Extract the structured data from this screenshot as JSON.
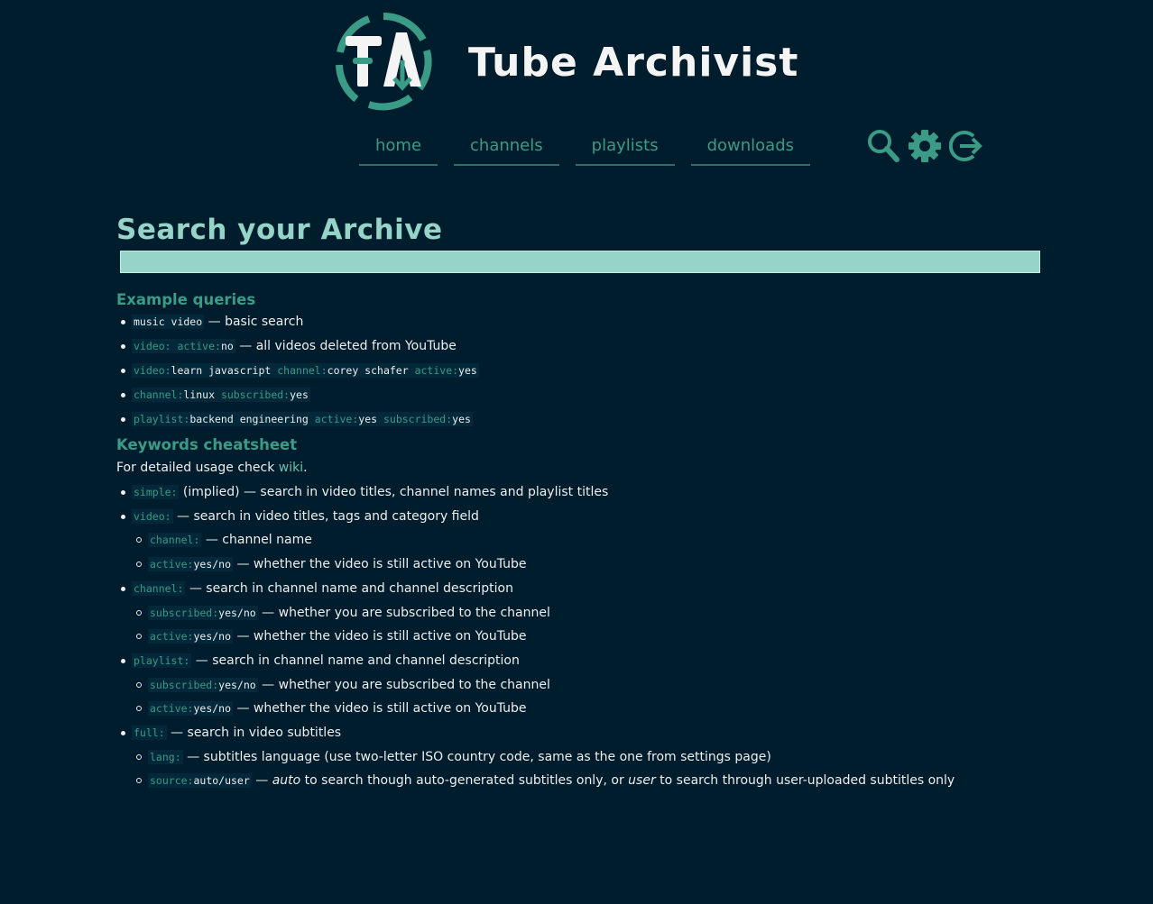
{
  "brand": {
    "title": "Tube Archivist",
    "logo_letters": "TA"
  },
  "nav": {
    "items": [
      {
        "label": "home"
      },
      {
        "label": "channels"
      },
      {
        "label": "playlists"
      },
      {
        "label": "downloads"
      }
    ],
    "icons": [
      "search-icon",
      "gear-icon",
      "logout-icon"
    ]
  },
  "main": {
    "title": "Search your Archive",
    "search": {
      "value": "",
      "placeholder": ""
    },
    "examples_heading": "Example queries",
    "examples": [
      {
        "code": [
          [
            "music video",
            false
          ]
        ],
        "desc": " — basic search"
      },
      {
        "code": [
          [
            "video:",
            true
          ],
          [
            " ",
            false
          ],
          [
            "active:",
            true
          ],
          [
            "no",
            false
          ]
        ],
        "desc": " — all videos deleted from YouTube"
      },
      {
        "code": [
          [
            "video:",
            true
          ],
          [
            "learn javascript ",
            false
          ],
          [
            "channel:",
            true
          ],
          [
            "corey schafer ",
            false
          ],
          [
            "active:",
            true
          ],
          [
            "yes",
            false
          ]
        ],
        "desc": ""
      },
      {
        "code": [
          [
            "channel:",
            true
          ],
          [
            "linux ",
            false
          ],
          [
            "subscribed:",
            true
          ],
          [
            "yes",
            false
          ]
        ],
        "desc": ""
      },
      {
        "code": [
          [
            "playlist:",
            true
          ],
          [
            "backend engineering ",
            false
          ],
          [
            "active:",
            true
          ],
          [
            "yes ",
            false
          ],
          [
            "subscribed:",
            true
          ],
          [
            "yes",
            false
          ]
        ],
        "desc": ""
      }
    ],
    "cheatsheet_heading": "Keywords cheatsheet",
    "usage_prefix": "For detailed usage check ",
    "usage_link": "wiki",
    "usage_suffix": ".",
    "keywords": [
      {
        "kw": "simple:",
        "val": "",
        "desc": " (implied) — search in video titles, channel names and playlist titles",
        "sub": []
      },
      {
        "kw": "video:",
        "val": "",
        "desc": " — search in video titles, tags and category field",
        "sub": [
          {
            "kw": "channel:",
            "val": "",
            "desc": " — channel name"
          },
          {
            "kw": "active:",
            "val": "yes/no",
            "desc": " — whether the video is still active on YouTube"
          }
        ]
      },
      {
        "kw": "channel:",
        "val": "",
        "desc": " — search in channel name and channel description",
        "sub": [
          {
            "kw": "subscribed:",
            "val": "yes/no",
            "desc": " — whether you are subscribed to the channel"
          },
          {
            "kw": "active:",
            "val": "yes/no",
            "desc": " — whether the video is still active on YouTube"
          }
        ]
      },
      {
        "kw": "playlist:",
        "val": "",
        "desc": " — search in channel name and channel description",
        "sub": [
          {
            "kw": "subscribed:",
            "val": "yes/no",
            "desc": " — whether you are subscribed to the channel"
          },
          {
            "kw": "active:",
            "val": "yes/no",
            "desc": " — whether the video is still active on YouTube"
          }
        ]
      },
      {
        "kw": "full:",
        "val": "",
        "desc": " — search in video subtitles",
        "sub": [
          {
            "kw": "lang:",
            "val": "",
            "desc": " — subtitles language (use two-letter ISO country code, same as the one from settings page)"
          },
          {
            "kw": "source:",
            "val": "auto/user",
            "rich": [
              [
                " — ",
                false
              ],
              [
                "auto",
                true
              ],
              [
                " to search though auto-generated subtitles only, or ",
                false
              ],
              [
                "user",
                true
              ],
              [
                " to search through user-uploaded subtitles only",
                false
              ]
            ]
          }
        ]
      }
    ]
  },
  "colors": {
    "background": "#001d2d",
    "accent": "#3a9b86",
    "title": "#97d4c8",
    "input_bg": "#97d4c8",
    "text": "#eeeeee"
  }
}
